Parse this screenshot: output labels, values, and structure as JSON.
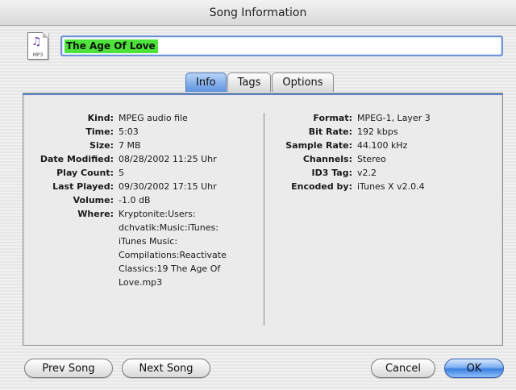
{
  "window": {
    "title": "Song Information"
  },
  "file_icon": {
    "type_label": "MP3"
  },
  "song_name": "The Age Of Love",
  "tabs": [
    {
      "label": "Info"
    },
    {
      "label": "Tags"
    },
    {
      "label": "Options"
    }
  ],
  "info_left": [
    {
      "label": "Kind:",
      "value": "MPEG audio file"
    },
    {
      "label": "Time:",
      "value": "5:03"
    },
    {
      "label": "Size:",
      "value": "7 MB"
    },
    {
      "label": "Date Modified:",
      "value": "08/28/2002 11:25 Uhr"
    },
    {
      "label": "Play Count:",
      "value": "5"
    },
    {
      "label": "Last Played:",
      "value": "09/30/2002 17:15 Uhr"
    },
    {
      "label": "Volume:",
      "value": "-1.0 dB"
    },
    {
      "label": "Where:",
      "value": "Kryptonite:Users: dchvatik:Music:iTunes: iTunes Music: Compilations:Reactivate Classics:19 The Age Of Love.mp3"
    }
  ],
  "info_right": [
    {
      "label": "Format:",
      "value": "MPEG-1, Layer 3"
    },
    {
      "label": "Bit Rate:",
      "value": "192 kbps"
    },
    {
      "label": "Sample Rate:",
      "value": "44.100 kHz"
    },
    {
      "label": "Channels:",
      "value": "Stereo"
    },
    {
      "label": "ID3 Tag:",
      "value": "v2.2"
    },
    {
      "label": "Encoded by:",
      "value": "iTunes X v2.0.4"
    }
  ],
  "buttons": {
    "prev": "Prev Song",
    "next": "Next Song",
    "cancel": "Cancel",
    "ok": "OK"
  }
}
